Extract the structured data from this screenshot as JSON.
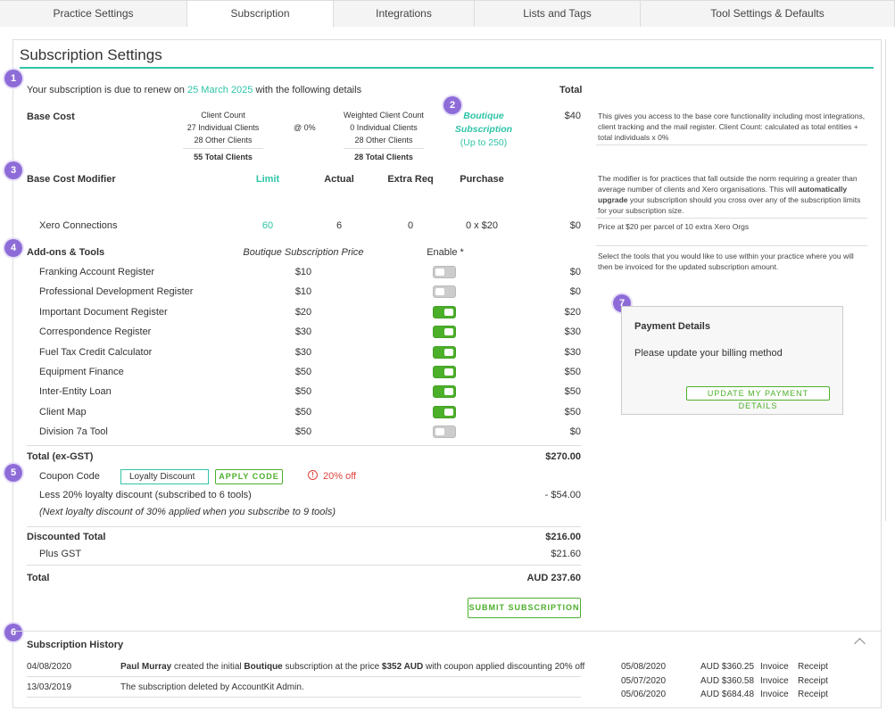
{
  "tabs": [
    "Practice Settings",
    "Subscription",
    "Integrations",
    "Lists and Tags",
    "Tool Settings & Defaults"
  ],
  "page_title": "Subscription Settings",
  "renewal": {
    "prefix": "Your subscription is due to renew on",
    "date": "25 March 2025",
    "suffix": "with the following details"
  },
  "total_header": "Total",
  "base_cost": {
    "label": "Base Cost",
    "client_count_header": "Client Count",
    "client_individual": "27 Individual Clients",
    "client_other": "28 Other Clients",
    "client_total": "55 Total Clients",
    "at_rate": "@ 0%",
    "weighted_header": "Weighted Client Count",
    "weighted_individual": "0 Individual Clients",
    "weighted_other": "28 Other Clients",
    "weighted_total": "28 Total Clients",
    "plan_line1": "Boutique",
    "plan_line2": "Subscription",
    "plan_limit": "(Up to 250)",
    "total": "$40",
    "note": "This gives you access to the base core functionality including most integrations, client tracking and the mail register. Client Count: calculated as total entities + total individuals x 0%"
  },
  "modifier": {
    "label": "Base Cost Modifier",
    "headers": {
      "limit": "Limit",
      "actual": "Actual",
      "extra": "Extra Req",
      "purchase": "Purchase"
    },
    "row": {
      "name": "Xero Connections",
      "limit": "60",
      "actual": "6",
      "extra": "0",
      "purchase": "0 x $20",
      "total": "$0"
    },
    "note_pre": "The modifier is for practices that fall outside the norm requiring a greater than average number of clients and Xero organisations. This will ",
    "note_bold": "automatically upgrade",
    "note_post": " your subscription should you cross over any of the subscription limits for your subscription size.",
    "price_note": "Price at $20 per parcel of 10 extra Xero Orgs"
  },
  "addons": {
    "label": "Add-ons & Tools",
    "price_header": "Boutique Subscription Price",
    "enable_header": "Enable *",
    "note": "Select the tools that you would like to use within your practice where you will then be invoiced for the updated subscription amount.",
    "items": [
      {
        "name": "Franking Account Register",
        "price": "$10",
        "enabled": false,
        "total": "$0"
      },
      {
        "name": "Professional Development Register",
        "price": "$10",
        "enabled": false,
        "total": "$0"
      },
      {
        "name": "Important Document Register",
        "price": "$20",
        "enabled": true,
        "total": "$20"
      },
      {
        "name": "Correspondence Register",
        "price": "$30",
        "enabled": true,
        "total": "$30"
      },
      {
        "name": "Fuel Tax Credit Calculator",
        "price": "$30",
        "enabled": true,
        "total": "$30"
      },
      {
        "name": "Equipment Finance",
        "price": "$50",
        "enabled": true,
        "total": "$50"
      },
      {
        "name": "Inter-Entity Loan",
        "price": "$50",
        "enabled": true,
        "total": "$50"
      },
      {
        "name": "Client Map",
        "price": "$50",
        "enabled": true,
        "total": "$50"
      },
      {
        "name": "Division 7a Tool",
        "price": "$50",
        "enabled": false,
        "total": "$0"
      }
    ]
  },
  "totals": {
    "ex_gst_label": "Total (ex-GST)",
    "ex_gst_value": "$270.00",
    "coupon_label": "Coupon Code",
    "coupon_value": "Loyalty Discount",
    "apply_label": "APPLY CODE",
    "coupon_result": "20% off",
    "loyalty_line": "Less 20% loyalty discount (subscribed to 6 tools)",
    "loyalty_value": "- $54.00",
    "next_loyalty": "(Next loyalty discount of 30% applied when you subscribe to 9 tools)",
    "discounted_label": "Discounted Total",
    "discounted_value": "$216.00",
    "gst_label": "Plus GST",
    "gst_value": "$21.60",
    "total_label": "Total",
    "total_value": "AUD 237.60",
    "submit_label": "SUBMIT SUBSCRIPTION"
  },
  "payment": {
    "title": "Payment Details",
    "message": "Please update your billing method",
    "button": "UPDATE MY PAYMENT DETAILS"
  },
  "history": {
    "title": "Subscription History",
    "entries": [
      {
        "date": "04/08/2020",
        "user": "Paul Murray",
        "t1": " created the initial ",
        "plan": "Boutique",
        "t2": " subscription at the price ",
        "price": "$352 AUD",
        "t3": " with coupon applied discounting 20% off"
      },
      {
        "date": "13/03/2019",
        "text": "The subscription deleted by AccountKit Admin."
      }
    ],
    "invoices": [
      {
        "date": "05/08/2020",
        "amount": "AUD $360.25",
        "invoice": "Invoice",
        "receipt": "Receipt"
      },
      {
        "date": "05/07/2020",
        "amount": "AUD $360.58",
        "invoice": "Invoice",
        "receipt": "Receipt"
      },
      {
        "date": "05/06/2020",
        "amount": "AUD $684.48",
        "invoice": "Invoice",
        "receipt": "Receipt"
      }
    ]
  },
  "badges": [
    "1",
    "2",
    "3",
    "4",
    "5",
    "6",
    "7"
  ],
  "colors": {
    "accent": "#2ec4a6",
    "toggle_on": "#4caf2a",
    "badge": "#8e6cd8",
    "warning": "#e0443e"
  }
}
